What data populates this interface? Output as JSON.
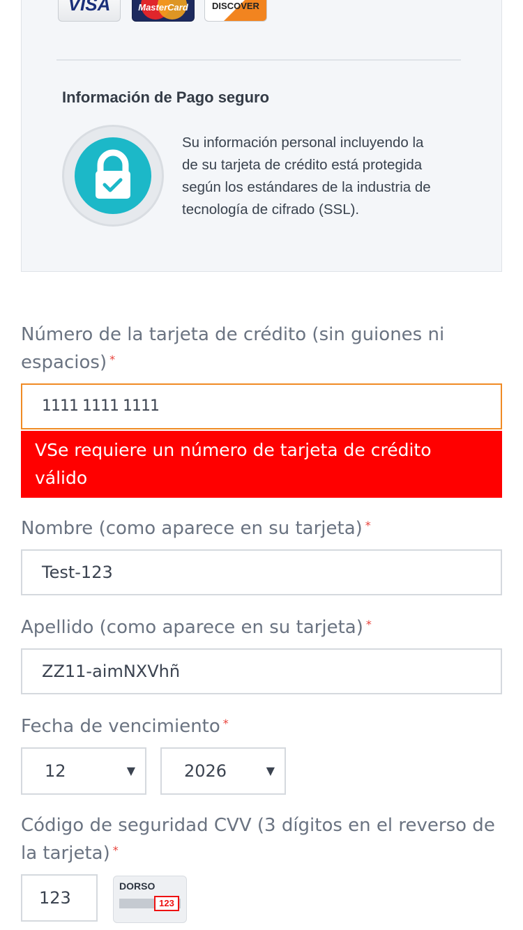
{
  "card_logos": {
    "visa": "VISA",
    "mastercard": "MasterCard",
    "discover": "DISCOVER"
  },
  "secure_info": {
    "title": "Información de Pago seguro",
    "line1": "Su información personal incluyendo la",
    "line2": "de su tarjeta de crédito está protegida",
    "line3": "según los estándares de la industria de",
    "line4": "tecnología de cifrado (SSL)."
  },
  "form": {
    "required_mark": "*",
    "card_number": {
      "label": "Número de la tarjeta de crédito (sin guiones ni espacios)",
      "value": "1111 1111 1111",
      "error": "VSe requiere un número de tarjeta de crédito válido"
    },
    "first_name": {
      "label": "Nombre (como aparece en su tarjeta)",
      "value": "Test-123"
    },
    "last_name": {
      "label": "Apellido (como aparece en su tarjeta)",
      "value": "ZZ11-aimNXVhñ"
    },
    "expiry": {
      "label": "Fecha de vencimiento",
      "month": "12",
      "year": "2026"
    },
    "cvv": {
      "label": "Código de seguridad CVV (3 dígitos en el reverso de la tarjeta)",
      "value": "123",
      "hint_title": "DORSO",
      "hint_code": "123"
    }
  },
  "colors": {
    "error_bg": "#ff0000",
    "error_border": "#f08a24",
    "lock_accent": "#1cb8c8",
    "required": "#e8423b"
  },
  "icons": {
    "lock": "lock-check-icon",
    "dropdown": "chevron-down-icon"
  }
}
